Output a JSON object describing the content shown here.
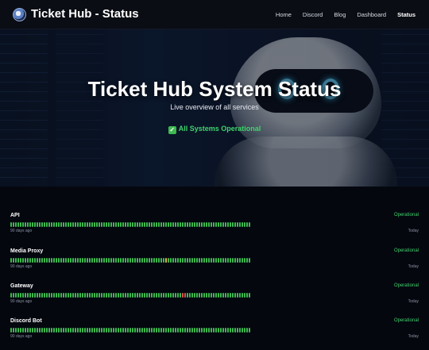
{
  "header": {
    "brand": "Ticket Hub - Status",
    "nav": [
      "Home",
      "Discord",
      "Blog",
      "Dashboard",
      "Status"
    ],
    "active_nav": "Status"
  },
  "hero": {
    "title": "Ticket Hub System Status",
    "subtitle": "Live overview of all services",
    "status": "All Systems Operational",
    "status_icon": "check-mark-icon"
  },
  "services": [
    {
      "name": "API",
      "state": "Operational",
      "left": "90 days ago",
      "right": "Today",
      "incidents": {}
    },
    {
      "name": "Media Proxy",
      "state": "Operational",
      "left": "90 days ago",
      "right": "Today",
      "incidents": {
        "65": "y"
      }
    },
    {
      "name": "Gateway",
      "state": "Operational",
      "left": "90 days ago",
      "right": "Today",
      "incidents": {
        "72": "r",
        "73": "r"
      }
    },
    {
      "name": "Discord Bot",
      "state": "Operational",
      "left": "90 days ago",
      "right": "Today",
      "incidents": {}
    }
  ],
  "colors": {
    "operational": "#3fb950",
    "degraded": "#e3b341",
    "outage": "#d9534f"
  }
}
